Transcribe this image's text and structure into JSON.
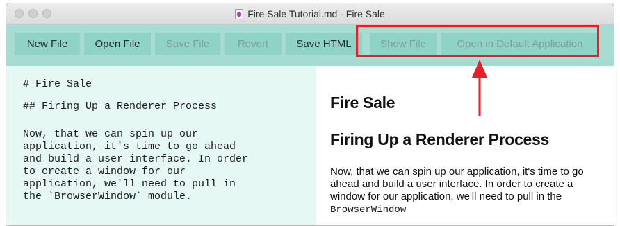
{
  "window": {
    "title": "Fire Sale Tutorial.md - Fire Sale"
  },
  "toolbar": {
    "buttons": [
      {
        "label": "New File",
        "enabled": true
      },
      {
        "label": "Open File",
        "enabled": true
      },
      {
        "label": "Save File",
        "enabled": false
      },
      {
        "label": "Revert",
        "enabled": false
      },
      {
        "label": "Save HTML",
        "enabled": true
      },
      {
        "label": "Show File",
        "enabled": false
      },
      {
        "label": "Open in Default Application",
        "enabled": false
      }
    ]
  },
  "editor": {
    "line1": "# Fire Sale",
    "line2": "## Firing Up a Renderer Process",
    "para_lines": [
      "Now, that we can spin up our",
      "application, it's time to go ahead",
      "and build a user interface. In order",
      "to create a window for our",
      "application, we'll need to pull in",
      "the `BrowserWindow` module."
    ]
  },
  "preview": {
    "h1": "Fire Sale",
    "h2": "Firing Up a Renderer Process",
    "paragraph": "Now, that we can spin up our application, it's time to go ahead and build a user interface. In order to create a window for our application, we'll need to pull in the",
    "code": "BrowserWindow"
  },
  "colors": {
    "toolbar_bg": "#a7dcd3",
    "button_bg": "#8fd2c6",
    "editor_bg": "#e6f8f4",
    "highlight": "#ec1d24"
  }
}
